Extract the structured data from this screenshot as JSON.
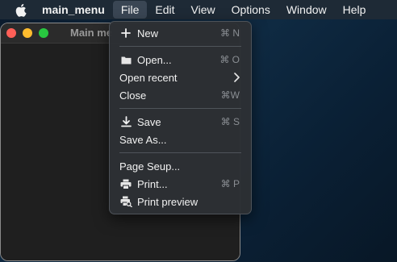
{
  "menubar": {
    "app_name": "main_menu",
    "items": [
      {
        "label": "File"
      },
      {
        "label": "Edit"
      },
      {
        "label": "View"
      },
      {
        "label": "Options"
      },
      {
        "label": "Window"
      },
      {
        "label": "Help"
      }
    ],
    "active_item": "File"
  },
  "window": {
    "title": "Main me"
  },
  "file_menu": {
    "items": [
      {
        "label": "New",
        "shortcut": "⌘ N",
        "icon": "plus-icon"
      },
      {
        "label": "Open...",
        "shortcut": "⌘ O",
        "icon": "folder-icon"
      },
      {
        "label": "Open recent",
        "icon": "chevron-right-icon"
      },
      {
        "label": "Close",
        "shortcut": "⌘W"
      },
      {
        "label": "Save",
        "shortcut": "⌘ S",
        "icon": "download-icon"
      },
      {
        "label": "Save As..."
      },
      {
        "label": "Page Seup..."
      },
      {
        "label": "Print...",
        "shortcut": "⌘ P",
        "icon": "printer-icon"
      },
      {
        "label": "Print preview",
        "icon": "print-preview-icon"
      }
    ]
  },
  "colors": {
    "menubar_bg": "#1e2a36",
    "menu_bg": "#2c2f34",
    "active_highlight": "#3a4654",
    "traffic_red": "#ff5f57",
    "traffic_yellow": "#febc2e",
    "traffic_green": "#28c840"
  }
}
